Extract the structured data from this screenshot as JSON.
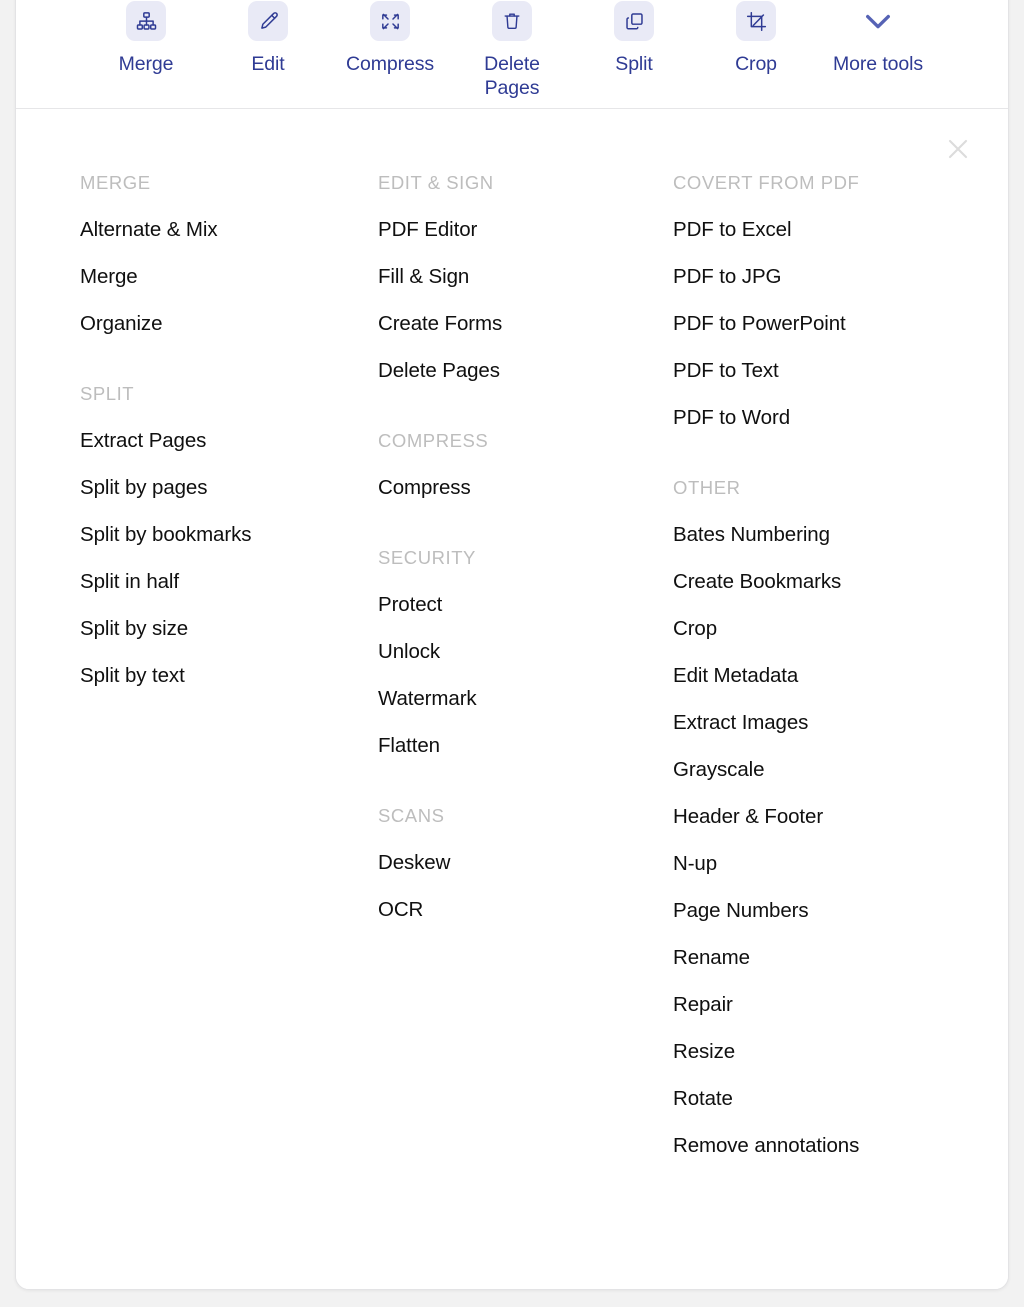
{
  "colors": {
    "accent_blue": "#2f3b94",
    "tile_bg": "#e9eaf6",
    "group_title": "#bdbdbd",
    "item_text": "#101010",
    "close_icon": "#dcdcdc",
    "panel_bg": "#ffffff",
    "page_bg": "#f2f2f2"
  },
  "toolbar": {
    "items": [
      {
        "label": "Merge",
        "icon": "merge-hierarchy-icon"
      },
      {
        "label": "Edit",
        "icon": "pencil-icon"
      },
      {
        "label": "Compress",
        "icon": "compress-arrows-icon"
      },
      {
        "label": "Delete Pages",
        "icon": "trash-icon"
      },
      {
        "label": "Split",
        "icon": "copy-pages-icon"
      },
      {
        "label": "Crop",
        "icon": "crop-icon"
      },
      {
        "label": "More tools",
        "icon": "chevron-down-icon"
      }
    ]
  },
  "menu": {
    "close_label": "×",
    "columns": [
      {
        "groups": [
          {
            "title": "MERGE",
            "items": [
              "Alternate & Mix",
              "Merge",
              "Organize"
            ]
          },
          {
            "title": "SPLIT",
            "items": [
              "Extract Pages",
              "Split by pages",
              "Split by bookmarks",
              "Split in half",
              "Split by size",
              "Split by text"
            ]
          }
        ]
      },
      {
        "groups": [
          {
            "title": "EDIT & SIGN",
            "items": [
              "PDF Editor",
              "Fill & Sign",
              "Create Forms",
              "Delete Pages"
            ]
          },
          {
            "title": "COMPRESS",
            "items": [
              "Compress"
            ]
          },
          {
            "title": "SECURITY",
            "items": [
              "Protect",
              "Unlock",
              "Watermark",
              "Flatten"
            ]
          },
          {
            "title": "SCANS",
            "items": [
              "Deskew",
              "OCR"
            ]
          }
        ]
      },
      {
        "groups": [
          {
            "title": "COVERT FROM PDF",
            "items": [
              "PDF to Excel",
              "PDF to JPG",
              "PDF to PowerPoint",
              "PDF to Text",
              "PDF to Word"
            ]
          },
          {
            "title": "OTHER",
            "items": [
              "Bates Numbering",
              "Create Bookmarks",
              "Crop",
              "Edit Metadata",
              "Extract Images",
              "Grayscale",
              "Header & Footer",
              "N-up",
              "Page Numbers",
              "Rename",
              "Repair",
              "Resize",
              "Rotate",
              "Remove annotations"
            ]
          }
        ]
      }
    ]
  }
}
